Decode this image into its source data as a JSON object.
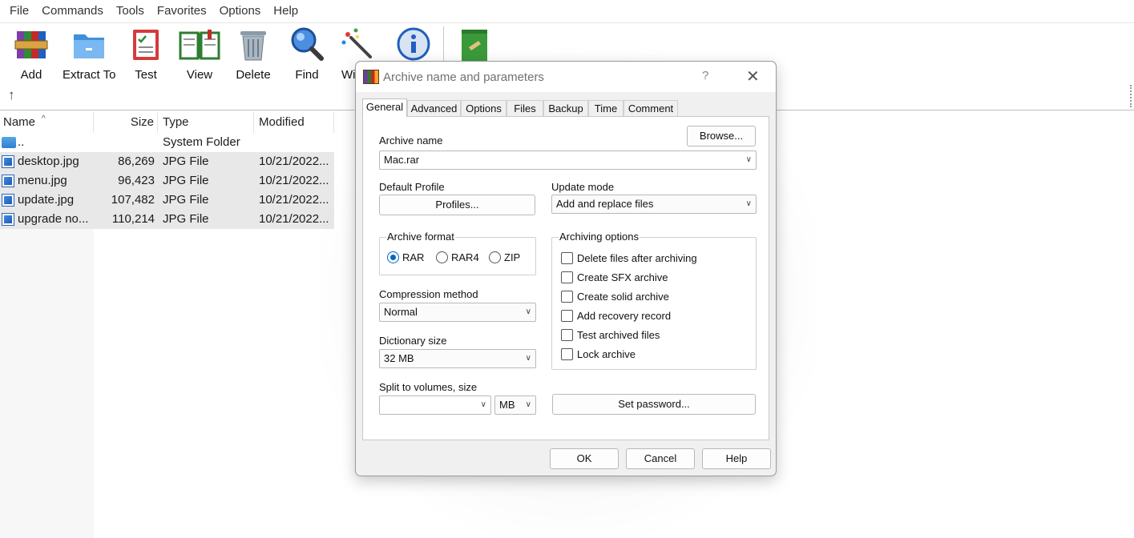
{
  "menu": [
    "File",
    "Commands",
    "Tools",
    "Favorites",
    "Options",
    "Help"
  ],
  "toolbar": {
    "add": "Add",
    "extract_to": "Extract To",
    "test": "Test",
    "view": "View",
    "delete": "Delete",
    "find": "Find",
    "wizard": "Wi",
    "info": "",
    "repair": ""
  },
  "filelist": {
    "columns": {
      "name": "Name",
      "size": "Size",
      "type": "Type",
      "modified": "Modified"
    },
    "rows": [
      {
        "name": "..",
        "size": "",
        "type": "System Folder",
        "modified": ""
      },
      {
        "name": "desktop.jpg",
        "size": "86,269",
        "type": "JPG File",
        "modified": "10/21/2022..."
      },
      {
        "name": "menu.jpg",
        "size": "96,423",
        "type": "JPG File",
        "modified": "10/21/2022..."
      },
      {
        "name": "update.jpg",
        "size": "107,482",
        "type": "JPG File",
        "modified": "10/21/2022..."
      },
      {
        "name": "upgrade no...",
        "size": "110,214",
        "type": "JPG File",
        "modified": "10/21/2022..."
      }
    ]
  },
  "dialog": {
    "title": "Archive name and parameters",
    "help_glyph": "?",
    "close_glyph": "✕",
    "tabs": [
      "General",
      "Advanced",
      "Options",
      "Files",
      "Backup",
      "Time",
      "Comment"
    ],
    "active_tab": "General",
    "archive_name_label": "Archive name",
    "browse": "Browse...",
    "archive_name_value": "Mac.rar",
    "default_profile_label": "Default Profile",
    "profiles": "Profiles...",
    "update_mode_label": "Update mode",
    "update_mode_value": "Add and replace files",
    "archive_format_label": "Archive format",
    "formats": [
      "RAR",
      "RAR4",
      "ZIP"
    ],
    "selected_format": "RAR",
    "compression_method_label": "Compression method",
    "compression_method_value": "Normal",
    "dictionary_size_label": "Dictionary size",
    "dictionary_size_value": "32 MB",
    "split_label": "Split to volumes, size",
    "split_value": "",
    "split_unit": "MB",
    "archiving_options_label": "Archiving options",
    "options": [
      {
        "label": "Delete files after archiving",
        "checked": false
      },
      {
        "label": "Create SFX archive",
        "checked": false
      },
      {
        "label": "Create solid archive",
        "checked": false
      },
      {
        "label": "Add recovery record",
        "checked": false
      },
      {
        "label": "Test archived files",
        "checked": false
      },
      {
        "label": "Lock archive",
        "checked": false
      }
    ],
    "set_password": "Set password...",
    "ok": "OK",
    "cancel": "Cancel",
    "help": "Help"
  }
}
